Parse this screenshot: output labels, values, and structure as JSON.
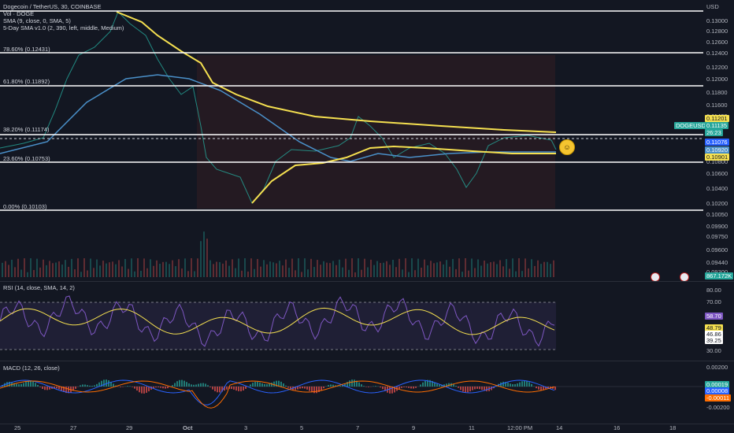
{
  "symbol_line": "Dogecoin / TetherUS, 30, COINBASE",
  "indicators": {
    "vol": "Vol · DOGE",
    "sma": "SMA (9, close, 0, SMA, 5)",
    "fiveday": "5-Day SMA v1.0 (2, 390, left, middle, Medium)",
    "rsi": "RSI (14, close, SMA, 14, 2)",
    "macd": "MACD (12, 26, close)"
  },
  "currency": "USD",
  "fib_levels": [
    {
      "label": "78.60% (0.12431)",
      "price": 0.12431
    },
    {
      "label": "61.80% (0.11892)",
      "price": 0.11892
    },
    {
      "label": "38.20% (0.11174)",
      "price": 0.11174
    },
    {
      "label": "23.60% (0.10753)",
      "price": 0.10753
    },
    {
      "label": "0.00% (0.10103)",
      "price": 0.10103
    }
  ],
  "price_axis": [
    "0.13000",
    "0.12800",
    "0.12600",
    "0.12400",
    "0.12200",
    "0.12000",
    "0.11800",
    "0.11600",
    "0.11400",
    "0.11135",
    "0.11076",
    "0.10920",
    "0.10800",
    "0.10600",
    "0.10400",
    "0.10200",
    "0.10050",
    "0.09900",
    "0.09750",
    "0.09600",
    "0.09440",
    "0.09300"
  ],
  "price_tags": {
    "sma_top": "0.11201",
    "symbol": "DOGEUSD",
    "last": "0.11135",
    "countdown": "26:23",
    "blue": "0.11076",
    "mid": "0.10920",
    "yellow_low": "0.10901",
    "volume": "867.172K"
  },
  "rsi_axis": [
    "80.00",
    "70.00",
    "58.70",
    "48.79",
    "46.86",
    "39.25",
    "30.00"
  ],
  "macd_axis": [
    "0.00200",
    "0.00019",
    "0.00008",
    "-0.00011",
    "-0.00200"
  ],
  "time_axis": [
    "25",
    "27",
    "29",
    "Oct",
    "3",
    "5",
    "7",
    "9",
    "11",
    "12:00 PM",
    "14",
    "16",
    "18"
  ],
  "colors": {
    "accent_green": "#26a69a",
    "accent_red": "#ef5350",
    "sma_yellow": "#f5e050",
    "ma_blue": "#4a90c9",
    "rsi_purple": "#7e57c2"
  }
}
